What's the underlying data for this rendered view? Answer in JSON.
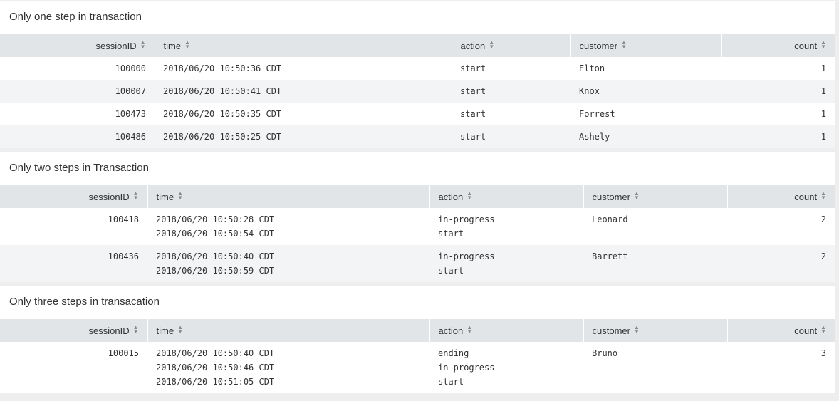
{
  "headers": {
    "sessionID": "sessionID",
    "time": "time",
    "action": "action",
    "customer": "customer",
    "count": "count"
  },
  "panels": [
    {
      "title": "Only one step in transaction",
      "rows": [
        {
          "sessionID": "100000",
          "time": [
            "2018/06/20 10:50:36 CDT"
          ],
          "action": [
            "start"
          ],
          "customer": "Elton",
          "count": "1"
        },
        {
          "sessionID": "100007",
          "time": [
            "2018/06/20 10:50:41 CDT"
          ],
          "action": [
            "start"
          ],
          "customer": "Knox",
          "count": "1"
        },
        {
          "sessionID": "100473",
          "time": [
            "2018/06/20 10:50:35 CDT"
          ],
          "action": [
            "start"
          ],
          "customer": "Forrest",
          "count": "1"
        },
        {
          "sessionID": "100486",
          "time": [
            "2018/06/20 10:50:25 CDT"
          ],
          "action": [
            "start"
          ],
          "customer": "Ashely",
          "count": "1"
        }
      ]
    },
    {
      "title": "Only two steps in Transaction",
      "rows": [
        {
          "sessionID": "100418",
          "time": [
            "2018/06/20 10:50:28 CDT",
            "2018/06/20 10:50:54 CDT"
          ],
          "action": [
            "in-progress",
            "start"
          ],
          "customer": "Leonard",
          "count": "2"
        },
        {
          "sessionID": "100436",
          "time": [
            "2018/06/20 10:50:40 CDT",
            "2018/06/20 10:50:59 CDT"
          ],
          "action": [
            "in-progress",
            "start"
          ],
          "customer": "Barrett",
          "count": "2"
        }
      ]
    },
    {
      "title": "Only three steps in transacation",
      "rows": [
        {
          "sessionID": "100015",
          "time": [
            "2018/06/20 10:50:40 CDT",
            "2018/06/20 10:50:46 CDT",
            "2018/06/20 10:51:05 CDT"
          ],
          "action": [
            "ending",
            "in-progress",
            "start"
          ],
          "customer": "Bruno",
          "count": "3"
        }
      ]
    }
  ]
}
